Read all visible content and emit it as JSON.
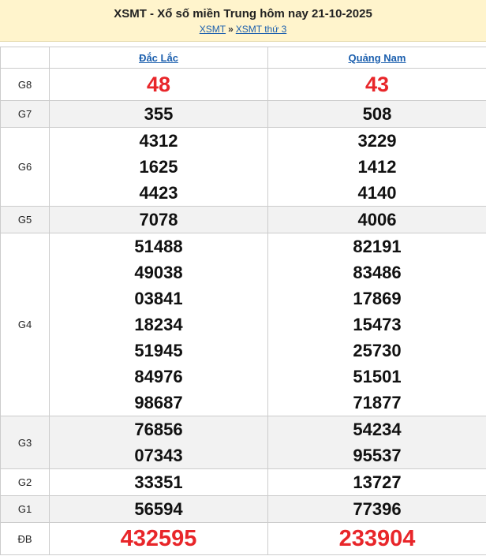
{
  "header": {
    "title": "XSMT - Xổ số miền Trung hôm nay 21-10-2025",
    "crumb_1": "XSMT",
    "crumb_sep": "»",
    "crumb_2": "XSMT thứ 3"
  },
  "provinces": [
    "Đắc Lắc",
    "Quảng Nam"
  ],
  "prizes": {
    "g8": {
      "label": "G8",
      "p1": [
        "48"
      ],
      "p2": [
        "43"
      ]
    },
    "g7": {
      "label": "G7",
      "p1": [
        "355"
      ],
      "p2": [
        "508"
      ]
    },
    "g6": {
      "label": "G6",
      "p1": [
        "4312",
        "1625",
        "4423"
      ],
      "p2": [
        "3229",
        "1412",
        "4140"
      ]
    },
    "g5": {
      "label": "G5",
      "p1": [
        "7078"
      ],
      "p2": [
        "4006"
      ]
    },
    "g4": {
      "label": "G4",
      "p1": [
        "51488",
        "49038",
        "03841",
        "18234",
        "51945",
        "84976",
        "98687"
      ],
      "p2": [
        "82191",
        "83486",
        "17869",
        "15473",
        "25730",
        "51501",
        "71877"
      ]
    },
    "g3": {
      "label": "G3",
      "p1": [
        "76856",
        "07343"
      ],
      "p2": [
        "54234",
        "95537"
      ]
    },
    "g2": {
      "label": "G2",
      "p1": [
        "33351"
      ],
      "p2": [
        "13727"
      ]
    },
    "g1": {
      "label": "G1",
      "p1": [
        "56594"
      ],
      "p2": [
        "77396"
      ]
    },
    "db": {
      "label": "ĐB",
      "p1": [
        "432595"
      ],
      "p2": [
        "233904"
      ]
    }
  },
  "colors": {
    "accent_red": "#e8262a",
    "link_blue": "#1b5fae",
    "header_bg": "#fff4cc"
  }
}
